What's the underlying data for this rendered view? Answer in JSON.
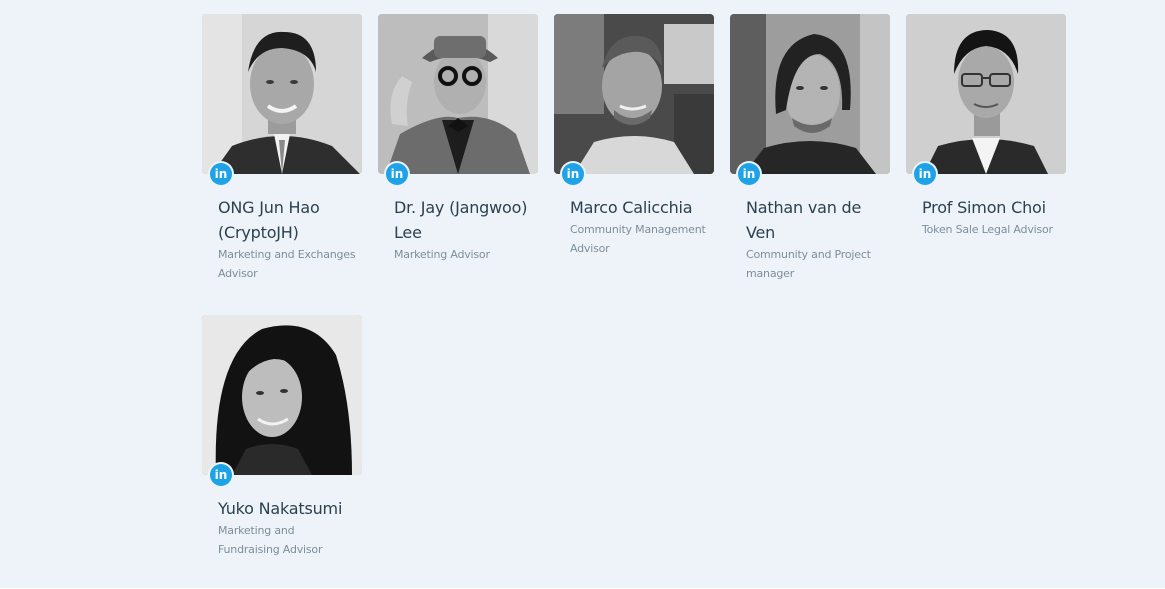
{
  "advisors": [
    {
      "name": "ONG Jun Hao (CryptoJH)",
      "role": "Marketing and Exchanges Advisor",
      "linkedin_label": "in",
      "photo_icon": "person-photo"
    },
    {
      "name": "Dr. Jay (Jangwoo) Lee",
      "role": "Marketing Advisor",
      "linkedin_label": "in",
      "photo_icon": "person-photo"
    },
    {
      "name": "Marco Calicchia",
      "role": "Community Management Advisor",
      "linkedin_label": "in",
      "photo_icon": "person-photo"
    },
    {
      "name": "Nathan van de Ven",
      "role": "Community and Project manager",
      "linkedin_label": "in",
      "photo_icon": "person-photo"
    },
    {
      "name": "Prof Simon Choi",
      "role": "Token Sale Legal Advisor",
      "linkedin_label": "in",
      "photo_icon": "person-photo"
    },
    {
      "name": "Yuko Nakatsumi",
      "role": "Marketing and Fundraising Advisor",
      "linkedin_label": "in",
      "photo_icon": "person-photo"
    }
  ],
  "colors": {
    "background": "#eef3f9",
    "name_text": "#2b4150",
    "role_text": "#7c8e9b",
    "linkedin_badge": "#1ea3e6"
  }
}
